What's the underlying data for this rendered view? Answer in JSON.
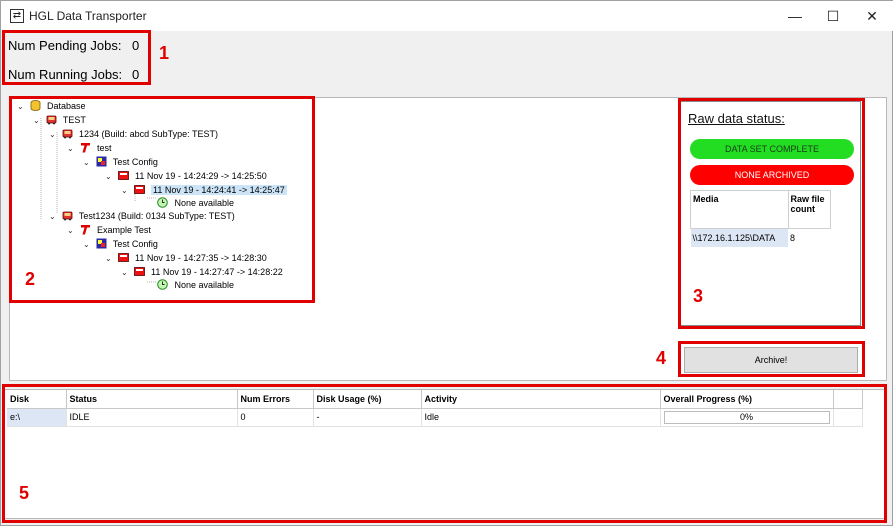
{
  "window": {
    "title": "HGL Data Transporter",
    "minimize": "—",
    "maximize": "☐",
    "close": "✕"
  },
  "stats": {
    "pending_label": "Num Pending Jobs:",
    "pending_value": "0",
    "running_label": "Num Running Jobs:",
    "running_value": "0"
  },
  "annotations": [
    "1",
    "2",
    "3",
    "4",
    "5"
  ],
  "tree": {
    "rows": [
      {
        "text": "Database",
        "icon": "database-icon"
      },
      {
        "text": "TEST",
        "icon": "bus-icon"
      },
      {
        "text": "1234 (Build: abcd  SubType: TEST)",
        "icon": "bus-icon"
      },
      {
        "text": "test",
        "icon": "t-icon"
      },
      {
        "text": "Test Config",
        "icon": "config-icon"
      },
      {
        "text": "11 Nov 19 - 14:24:29 -> 14:25:50",
        "icon": "run-icon"
      },
      {
        "text": "11 Nov 19 - 14:24:41 -> 14:25:47",
        "icon": "run-icon"
      },
      {
        "text": "None available",
        "icon": "clock-icon"
      },
      {
        "text": "Test1234 (Build: 0134  SubType: TEST)",
        "icon": "bus-icon"
      },
      {
        "text": "Example Test",
        "icon": "t-icon"
      },
      {
        "text": "Test Config",
        "icon": "config-icon"
      },
      {
        "text": "11 Nov 19 - 14:27:35 -> 14:28:30",
        "icon": "run-icon"
      },
      {
        "text": "11 Nov 19 - 14:27:47 -> 14:28:22",
        "icon": "run-icon"
      },
      {
        "text": "None available",
        "icon": "clock-icon"
      }
    ]
  },
  "raw_status": {
    "title": "Raw data status:",
    "complete_label": "DATA SET COMPLETE",
    "archived_label": "NONE ARCHIVED",
    "table_headers": [
      "Media",
      "Raw file count"
    ],
    "rows": [
      [
        "\\\\172.16.1.125\\DATA",
        "8"
      ]
    ],
    "colors": {
      "complete": "#22dd22",
      "archived": "#ff0000"
    }
  },
  "archive_button": "Archive!",
  "disks": {
    "headers": [
      "Disk",
      "Status",
      "Num Errors",
      "Disk Usage (%)",
      "Activity",
      "Overall Progress (%)",
      ""
    ],
    "rows": [
      {
        "disk": "e:\\",
        "status": "IDLE",
        "errors": "0",
        "usage": "-",
        "activity": "Idle",
        "progress_text": "0%",
        "progress": 0
      }
    ]
  }
}
